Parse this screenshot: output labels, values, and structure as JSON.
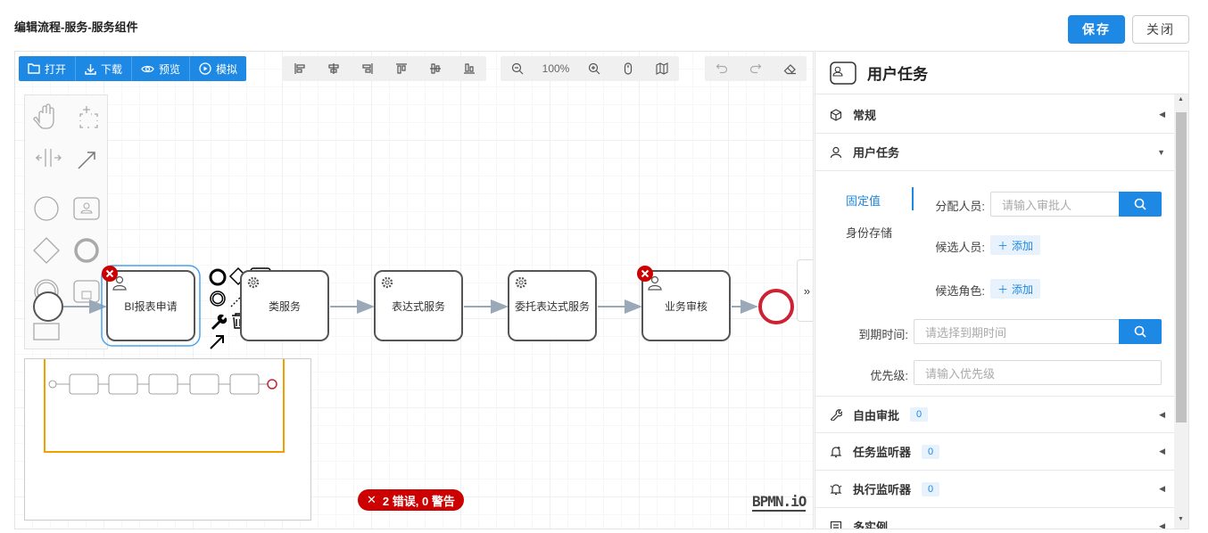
{
  "page_title": "编辑流程-服务-服务组件",
  "header": {
    "save_label": "保存",
    "close_label": "关闭"
  },
  "toolbar": {
    "open": "打开",
    "download": "下载",
    "preview": "预览",
    "simulate": "模拟",
    "zoom": "100%"
  },
  "tasks": [
    {
      "name": "BI报表申请",
      "type": "user",
      "error": true
    },
    {
      "name": "类服务",
      "type": "service",
      "error": false
    },
    {
      "name": "表达式服务",
      "type": "service",
      "error": false
    },
    {
      "name": "委托表达式服务",
      "type": "service",
      "error": false
    },
    {
      "name": "业务审核",
      "type": "user",
      "error": true
    }
  ],
  "error_badge": "2 错误, 0 警告",
  "logo": "BPMN.iO",
  "panel": {
    "title": "用户任务",
    "groups": {
      "general": "常规",
      "user_task": "用户任务"
    },
    "assign_tabs": {
      "fixed": "固定值",
      "identity": "身份存储"
    },
    "assignee_label": "分配人员:",
    "assignee_placeholder": "请输入审批人",
    "candidate_users_label": "候选人员:",
    "candidate_groups_label": "候选角色:",
    "add_label": "添加",
    "due_label": "到期时间:",
    "due_placeholder": "请选择到期时间",
    "priority_label": "优先级:",
    "priority_placeholder": "请输入优先级",
    "free_approval": "自由审批",
    "free_approval_count": "0",
    "task_listener": "任务监听器",
    "task_listener_count": "0",
    "exec_listener": "执行监听器",
    "exec_listener_count": "0",
    "multi_instance": "多实例"
  },
  "colors": {
    "primary": "#1e88e5",
    "error": "#cc0000",
    "selection": "#4aa3ee",
    "minimap_frame": "#f0a000"
  }
}
